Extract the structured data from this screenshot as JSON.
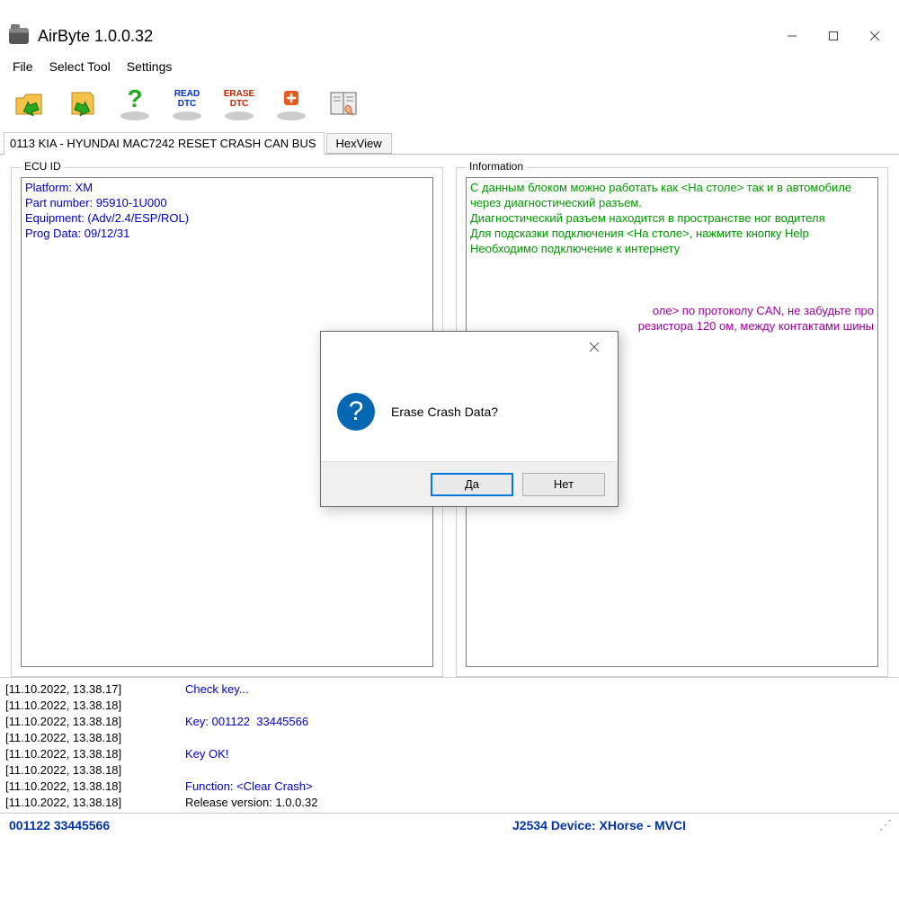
{
  "title": "AirByte  1.0.0.32",
  "menu": {
    "file": "File",
    "select_tool": "Select Tool",
    "settings": "Settings"
  },
  "toolbar": {
    "read_dtc_line1": "READ",
    "read_dtc_line2": "DTC",
    "erase_dtc_line1": "ERASE",
    "erase_dtc_line2": "DTC"
  },
  "tabs": {
    "active_label": "0113 KIA - HYUNDAI MAC7242 RESET CRASH CAN BUS",
    "hexview": "HexView"
  },
  "ecu": {
    "legend": "ECU ID",
    "platform": "Platform: XM",
    "part": "Part number: 95910-1U000",
    "equip": "Equipment: (Adv/2.4/ESP/ROL)",
    "prog": "Prog Data: 09/12/31"
  },
  "info": {
    "legend": "Information",
    "g1": "С данным блоком можно работать как <На столе> так и в автомобиле через диагностический разъем.",
    "g2": "Диагностический разъем находится в пространстве ног водителя",
    "g3": "Для подсказки подключения <На столе>, нажмите кнопку Help",
    "g4": "Необходимо подключение к интернету",
    "p1": "оле> по протоколу CAN, не забудьте про",
    "p2": "резистора 120 ом, между контактами шины"
  },
  "log": [
    {
      "ts": "[11.10.2022, 13.38.17]",
      "msg": "Check key...",
      "cls": "msg-blue"
    },
    {
      "ts": "[11.10.2022, 13.38.18]",
      "msg": "",
      "cls": ""
    },
    {
      "ts": "[11.10.2022, 13.38.18]",
      "msg": "Key: 001122  33445566",
      "cls": "msg-blue"
    },
    {
      "ts": "[11.10.2022, 13.38.18]",
      "msg": "",
      "cls": ""
    },
    {
      "ts": "[11.10.2022, 13.38.18]",
      "msg": "Key OK!",
      "cls": "msg-blue"
    },
    {
      "ts": "[11.10.2022, 13.38.18]",
      "msg": "",
      "cls": ""
    },
    {
      "ts": "[11.10.2022, 13.38.18]",
      "msg": "Function: <Clear Crash>",
      "cls": "msg-blue"
    },
    {
      "ts": "[11.10.2022, 13.38.18]",
      "msg": "Release version: 1.0.0.32",
      "cls": ""
    }
  ],
  "status": {
    "left": "001122  33445566",
    "right": "J2534 Device: XHorse - MVCI"
  },
  "dialog": {
    "message": "Erase Crash Data?",
    "yes": "Да",
    "no": "Нет"
  }
}
